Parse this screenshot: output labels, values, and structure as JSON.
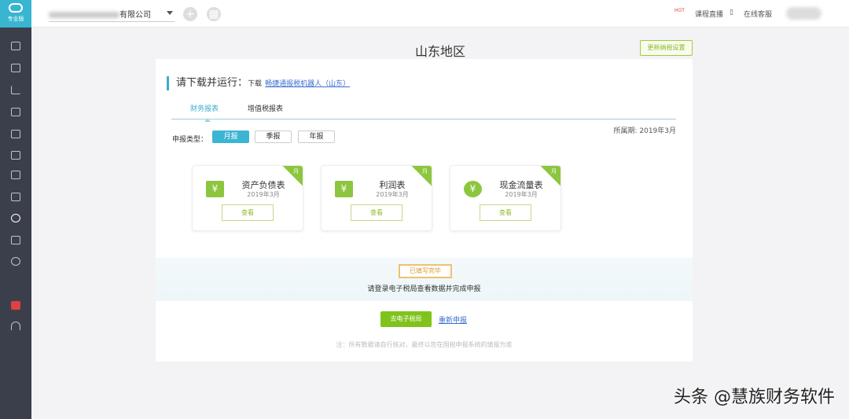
{
  "sidebar": {
    "logo_label": "专业版"
  },
  "topbar": {
    "company": "有限公司",
    "course_live": "课程直播",
    "online_service": "在线客服",
    "hot_badge": "HOT"
  },
  "page": {
    "title": "山东地区",
    "update_button": "更新纳税设置"
  },
  "download": {
    "heading": "请下载并运行：",
    "prefix": "下载",
    "link": "畅捷通报税机器人（山东）"
  },
  "tabs": [
    {
      "label": "财务报表"
    },
    {
      "label": "增值税报表"
    }
  ],
  "report_type": {
    "label": "申报类型：",
    "options": [
      "月报",
      "季报",
      "年报"
    ],
    "selected": "月报"
  },
  "period": "所属期: 2019年3月",
  "cards": [
    {
      "name": "资产负债表",
      "date": "2019年3月",
      "view": "查看",
      "badge": "月",
      "icon": "¥"
    },
    {
      "name": "利润表",
      "date": "2019年3月",
      "view": "查看",
      "badge": "月",
      "icon": "¥"
    },
    {
      "name": "现金流量表",
      "date": "2019年3月",
      "view": "查看",
      "badge": "月",
      "icon": "¥"
    }
  ],
  "status": {
    "badge": "已填写完毕",
    "message": "请登录电子税局查看数据并完成申报"
  },
  "actions": {
    "go": "去电子税局",
    "redo": "重新申报"
  },
  "note": "注：所有数据请自行核对，最终以您在国税申报系统的填报为准",
  "watermark": "头条 @慧族财务软件"
}
